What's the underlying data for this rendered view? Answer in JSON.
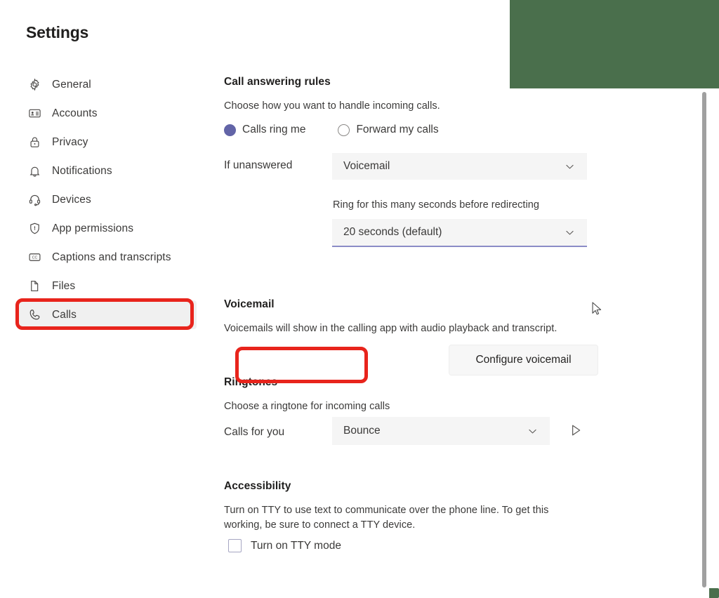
{
  "window": {
    "title": "Settings"
  },
  "sidebar": {
    "items": [
      {
        "label": "General",
        "icon": "gear-icon",
        "selected": false
      },
      {
        "label": "Accounts",
        "icon": "contact-card-icon",
        "selected": false
      },
      {
        "label": "Privacy",
        "icon": "lock-icon",
        "selected": false
      },
      {
        "label": "Notifications",
        "icon": "bell-icon",
        "selected": false
      },
      {
        "label": "Devices",
        "icon": "headset-icon",
        "selected": false
      },
      {
        "label": "App permissions",
        "icon": "shield-icon",
        "selected": false
      },
      {
        "label": "Captions and transcripts",
        "icon": "cc-icon",
        "selected": false
      },
      {
        "label": "Files",
        "icon": "file-icon",
        "selected": false
      },
      {
        "label": "Calls",
        "icon": "phone-icon",
        "selected": true
      }
    ]
  },
  "call_answering_rules": {
    "title": "Call answering rules",
    "description": "Choose how you want to handle incoming calls.",
    "options": [
      {
        "label": "Calls ring me",
        "selected": true
      },
      {
        "label": "Forward my calls",
        "selected": false
      }
    ],
    "if_unanswered_label": "If unanswered",
    "if_unanswered_value": "Voicemail",
    "ring_seconds_label": "Ring for this many seconds before redirecting",
    "ring_seconds_value": "20 seconds (default)"
  },
  "voicemail": {
    "title": "Voicemail",
    "description": "Voicemails will show in the calling app with audio playback and transcript.",
    "configure_button": "Configure voicemail"
  },
  "ringtones": {
    "title": "Ringtones",
    "description": "Choose a ringtone for incoming calls",
    "calls_for_you_label": "Calls for you",
    "calls_for_you_value": "Bounce",
    "preview_icon": "play-icon"
  },
  "accessibility": {
    "title": "Accessibility",
    "description": "Turn on TTY to use text to communicate over the phone line. To get this working, be sure to connect a TTY device.",
    "tty_checkbox_label": "Turn on TTY mode",
    "tty_checked": false
  },
  "colors": {
    "accent": "#6264a7",
    "annotation": "#e8241c",
    "overlay_green": "#4a6f4c",
    "field_bg": "#f5f5f5",
    "selected_nav_bg": "#f0f0f0"
  }
}
